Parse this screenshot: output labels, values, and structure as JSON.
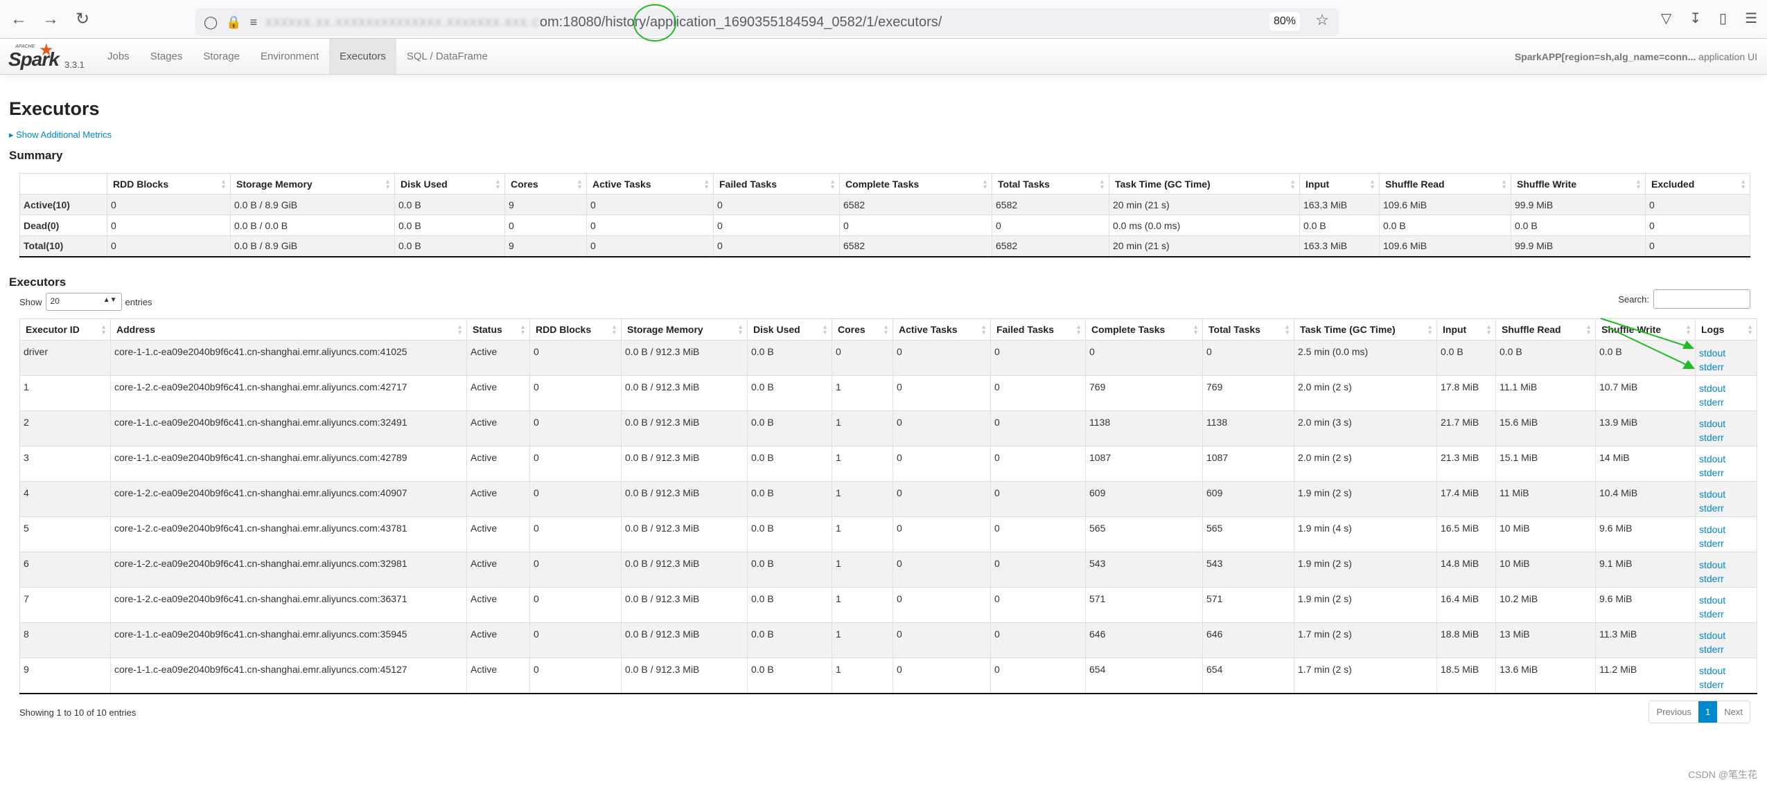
{
  "browser": {
    "url_blurred": "xxxxxx.xx.xxxxxxxxxxxxxx.xxxxxxx.xxx.c",
    "url_visible": "om:18080/history/application_1690355184594_0582/1/executors/",
    "zoom": "80%",
    "annotation_color": "#22bb22"
  },
  "nav": {
    "logo_apache": "APACHE",
    "logo_spark": "Spark",
    "version": "3.3.1",
    "tabs": [
      "Jobs",
      "Stages",
      "Storage",
      "Environment",
      "Executors",
      "SQL / DataFrame"
    ],
    "active_tab": "Executors",
    "app_name": "SparkAPP[region=sh,alg_name=conn...",
    "app_suffix": "application UI"
  },
  "page": {
    "title": "Executors",
    "show_metrics": "Show Additional Metrics",
    "summary_heading": "Summary",
    "executors_heading": "Executors"
  },
  "summary": {
    "headers": [
      "",
      "RDD Blocks",
      "Storage Memory",
      "Disk Used",
      "Cores",
      "Active Tasks",
      "Failed Tasks",
      "Complete Tasks",
      "Total Tasks",
      "Task Time (GC Time)",
      "Input",
      "Shuffle Read",
      "Shuffle Write",
      "Excluded"
    ],
    "rows": [
      [
        "Active(10)",
        "0",
        "0.0 B / 8.9 GiB",
        "0.0 B",
        "9",
        "0",
        "0",
        "6582",
        "6582",
        "20 min (21 s)",
        "163.3 MiB",
        "109.6 MiB",
        "99.9 MiB",
        "0"
      ],
      [
        "Dead(0)",
        "0",
        "0.0 B / 0.0 B",
        "0.0 B",
        "0",
        "0",
        "0",
        "0",
        "0",
        "0.0 ms (0.0 ms)",
        "0.0 B",
        "0.0 B",
        "0.0 B",
        "0"
      ],
      [
        "Total(10)",
        "0",
        "0.0 B / 8.9 GiB",
        "0.0 B",
        "9",
        "0",
        "0",
        "6582",
        "6582",
        "20 min (21 s)",
        "163.3 MiB",
        "109.6 MiB",
        "99.9 MiB",
        "0"
      ]
    ]
  },
  "table_controls": {
    "show_label": "Show",
    "page_size": "20",
    "entries_label": "entries",
    "search_label": "Search:",
    "search_value": "",
    "info": "Showing 1 to 10 of 10 entries",
    "previous": "Previous",
    "current_page": "1",
    "next": "Next"
  },
  "executors": {
    "headers": [
      "Executor ID",
      "Address",
      "Status",
      "RDD Blocks",
      "Storage Memory",
      "Disk Used",
      "Cores",
      "Active Tasks",
      "Failed Tasks",
      "Complete Tasks",
      "Total Tasks",
      "Task Time (GC Time)",
      "Input",
      "Shuffle Read",
      "Shuffle Write",
      "Logs"
    ],
    "log_links": [
      "stdout",
      "stderr"
    ],
    "rows": [
      [
        "driver",
        "core-1-1.c-ea09e2040b9f6c41.cn-shanghai.emr.aliyuncs.com:41025",
        "Active",
        "0",
        "0.0 B / 912.3 MiB",
        "0.0 B",
        "0",
        "0",
        "0",
        "0",
        "0",
        "2.5 min (0.0 ms)",
        "0.0 B",
        "0.0 B",
        "0.0 B"
      ],
      [
        "1",
        "core-1-2.c-ea09e2040b9f6c41.cn-shanghai.emr.aliyuncs.com:42717",
        "Active",
        "0",
        "0.0 B / 912.3 MiB",
        "0.0 B",
        "1",
        "0",
        "0",
        "769",
        "769",
        "2.0 min (2 s)",
        "17.8 MiB",
        "11.1 MiB",
        "10.7 MiB"
      ],
      [
        "2",
        "core-1-1.c-ea09e2040b9f6c41.cn-shanghai.emr.aliyuncs.com:32491",
        "Active",
        "0",
        "0.0 B / 912.3 MiB",
        "0.0 B",
        "1",
        "0",
        "0",
        "1138",
        "1138",
        "2.0 min (3 s)",
        "21.7 MiB",
        "15.6 MiB",
        "13.9 MiB"
      ],
      [
        "3",
        "core-1-1.c-ea09e2040b9f6c41.cn-shanghai.emr.aliyuncs.com:42789",
        "Active",
        "0",
        "0.0 B / 912.3 MiB",
        "0.0 B",
        "1",
        "0",
        "0",
        "1087",
        "1087",
        "2.0 min (2 s)",
        "21.3 MiB",
        "15.1 MiB",
        "14 MiB"
      ],
      [
        "4",
        "core-1-2.c-ea09e2040b9f6c41.cn-shanghai.emr.aliyuncs.com:40907",
        "Active",
        "0",
        "0.0 B / 912.3 MiB",
        "0.0 B",
        "1",
        "0",
        "0",
        "609",
        "609",
        "1.9 min (2 s)",
        "17.4 MiB",
        "11 MiB",
        "10.4 MiB"
      ],
      [
        "5",
        "core-1-2.c-ea09e2040b9f6c41.cn-shanghai.emr.aliyuncs.com:43781",
        "Active",
        "0",
        "0.0 B / 912.3 MiB",
        "0.0 B",
        "1",
        "0",
        "0",
        "565",
        "565",
        "1.9 min (4 s)",
        "16.5 MiB",
        "10 MiB",
        "9.6 MiB"
      ],
      [
        "6",
        "core-1-2.c-ea09e2040b9f6c41.cn-shanghai.emr.aliyuncs.com:32981",
        "Active",
        "0",
        "0.0 B / 912.3 MiB",
        "0.0 B",
        "1",
        "0",
        "0",
        "543",
        "543",
        "1.9 min (2 s)",
        "14.8 MiB",
        "10 MiB",
        "9.1 MiB"
      ],
      [
        "7",
        "core-1-2.c-ea09e2040b9f6c41.cn-shanghai.emr.aliyuncs.com:36371",
        "Active",
        "0",
        "0.0 B / 912.3 MiB",
        "0.0 B",
        "1",
        "0",
        "0",
        "571",
        "571",
        "1.9 min (2 s)",
        "16.4 MiB",
        "10.2 MiB",
        "9.6 MiB"
      ],
      [
        "8",
        "core-1-1.c-ea09e2040b9f6c41.cn-shanghai.emr.aliyuncs.com:35945",
        "Active",
        "0",
        "0.0 B / 912.3 MiB",
        "0.0 B",
        "1",
        "0",
        "0",
        "646",
        "646",
        "1.7 min (2 s)",
        "18.8 MiB",
        "13 MiB",
        "11.3 MiB"
      ],
      [
        "9",
        "core-1-1.c-ea09e2040b9f6c41.cn-shanghai.emr.aliyuncs.com:45127",
        "Active",
        "0",
        "0.0 B / 912.3 MiB",
        "0.0 B",
        "1",
        "0",
        "0",
        "654",
        "654",
        "1.7 min (2 s)",
        "18.5 MiB",
        "13.6 MiB",
        "11.2 MiB"
      ]
    ]
  },
  "watermark": "CSDN @笔生花"
}
